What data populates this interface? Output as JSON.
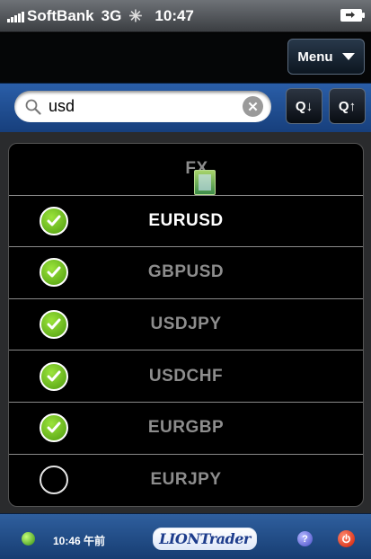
{
  "status_bar": {
    "carrier": "SoftBank",
    "network": "3G",
    "time": "10:47"
  },
  "nav": {
    "menu_label": "Menu"
  },
  "search": {
    "value": "usd",
    "sort_desc_label": "Q↓",
    "sort_asc_label": "Q↑"
  },
  "list": {
    "header": "FX",
    "items": [
      {
        "label": "EURUSD",
        "checked": true,
        "active": true
      },
      {
        "label": "GBPUSD",
        "checked": true,
        "active": false
      },
      {
        "label": "USDJPY",
        "checked": true,
        "active": false
      },
      {
        "label": "USDCHF",
        "checked": true,
        "active": false
      },
      {
        "label": "EURGBP",
        "checked": true,
        "active": false
      },
      {
        "label": "EURJPY",
        "checked": false,
        "active": false
      }
    ]
  },
  "footer": {
    "time": "10:46 午前",
    "logo": "LIONTrader",
    "help_label": "?"
  },
  "colors": {
    "search_bar": "#2a5ea8",
    "footer": "#2f5f9e",
    "check_green": "#6bbf1f",
    "power_red": "#e0260a"
  }
}
